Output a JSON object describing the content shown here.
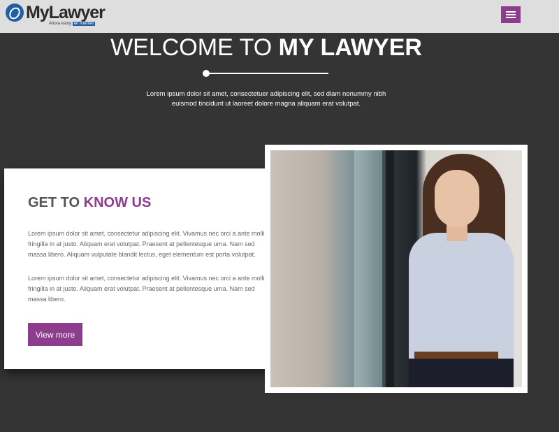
{
  "brand": {
    "name": "MyLawyer",
    "tagline_prefix": "Ahora estoy",
    "tagline_highlight": "en internet"
  },
  "navbar": {
    "menu_icon": "hamburger-menu-icon",
    "menu_color": "#8e3d8e"
  },
  "hero": {
    "title_regular": "WELCOME TO",
    "title_bold": "MY LAWYER",
    "text": "Lorem ipsum dolor sit amet, consectetuer adipiscing elit, sed diam nonummy nibh euismod tincidunt ut laoreet dolore magna aliquam erat volutpat."
  },
  "about": {
    "title_regular": "GET TO",
    "title_highlight": "KNOW US",
    "paragraph1": "Lorem ipsum dolor sit amet, consectetur adipiscing elit. Vivamus nec orci a ante mollis fringilla in at justo. Aliquam erat volutpat. Praesent at pellentesque urna. Nam sed massa libero. Aliquam vulputate blandit lectus, eget elementum est porta volutpat.",
    "paragraph2": "Lorem ipsum dolor sit amet, consectetur adipiscing elit. Vivamus nec orci a ante mollis fringilla in at justo. Aliquam erat volutpat. Praesent at pellentesque urna. Nam sed massa libero.",
    "button_label": "View more"
  },
  "colors": {
    "accent": "#8e3d8e",
    "background": "#343434",
    "navbar": "#dedede"
  }
}
